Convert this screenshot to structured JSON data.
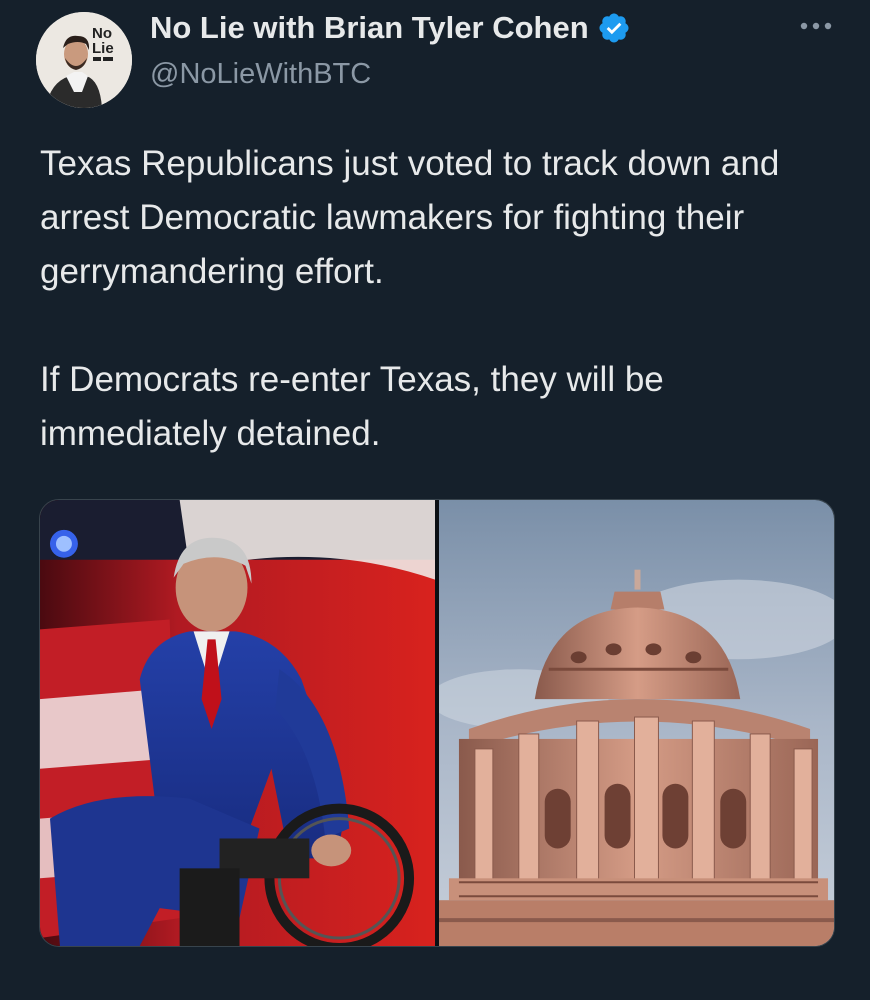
{
  "author": {
    "display_name": "No Lie with Brian Tyler Cohen",
    "handle": "@NoLieWithBTC",
    "avatar_badge_line1": "No",
    "avatar_badge_line2": "Lie"
  },
  "tweet": {
    "text": "Texas Republicans just voted to track down and arrest Democratic lawmakers for fighting their gerrymandering effort.\n\nIf Democrats re-enter Texas, they will be immediately detained."
  },
  "media": [
    {
      "icon": "person-in-wheelchair-photo"
    },
    {
      "icon": "texas-capitol-dome-photo"
    }
  ],
  "colors": {
    "background": "#15202b",
    "text_primary": "#e7e9ea",
    "text_secondary": "#8b98a5",
    "verified": "#1d9bf0"
  }
}
